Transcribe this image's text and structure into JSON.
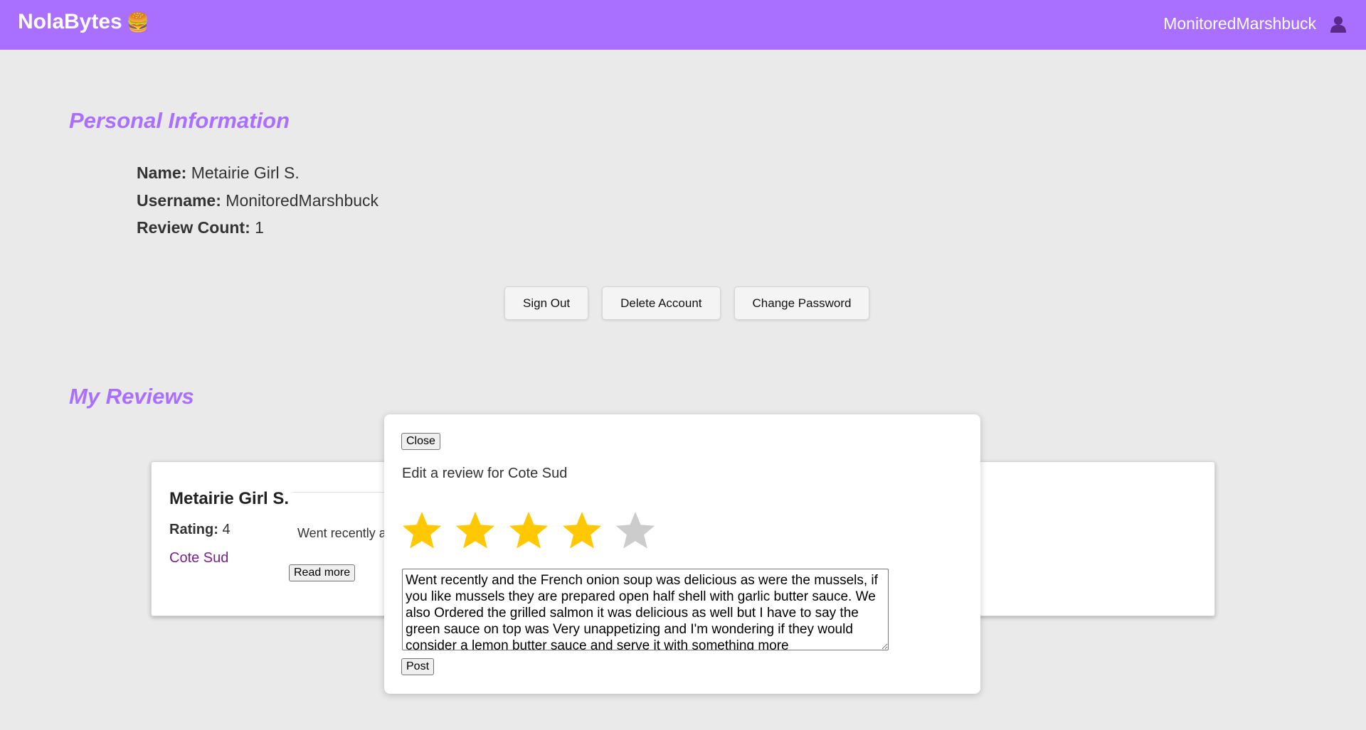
{
  "header": {
    "brand": "NolaBytes",
    "brand_emoji": "🍔",
    "username": "MonitoredMarshbuck",
    "user_icon": "user-icon",
    "brand_color": "#a970ff"
  },
  "personal_info": {
    "heading": "Personal Information",
    "name_label": "Name:",
    "name_value": "Metairie Girl S.",
    "username_label": "Username:",
    "username_value": "MonitoredMarshbuck",
    "review_count_label": "Review Count:",
    "review_count_value": "1"
  },
  "account_buttons": {
    "sign_out": "Sign Out",
    "delete_account": "Delete Account",
    "change_password": "Change Password"
  },
  "reviews": {
    "heading": "My Reviews",
    "items": [
      {
        "author": "Metairie Girl S.",
        "rating_label": "Rating:",
        "rating_value": "4",
        "restaurant": "Cote Sud",
        "snippet": "Went recently and the French onion soup",
        "read_more": "Read more"
      }
    ]
  },
  "modal": {
    "close_label": "Close",
    "title": "Edit a review for Cote Sud",
    "rating": 4,
    "max_rating": 5,
    "star_filled_color": "#ffc800",
    "star_empty_color": "#cccccc",
    "review_text": "Went recently and the French onion soup was delicious as were the mussels, if you like mussels they are prepared open half shell with garlic butter sauce. We also Ordered the grilled salmon it was delicious as well but I have to say the green sauce on top was Very unappetizing and I'm wondering if they would consider a lemon butter sauce and serve it with something more",
    "post_label": "Post"
  }
}
